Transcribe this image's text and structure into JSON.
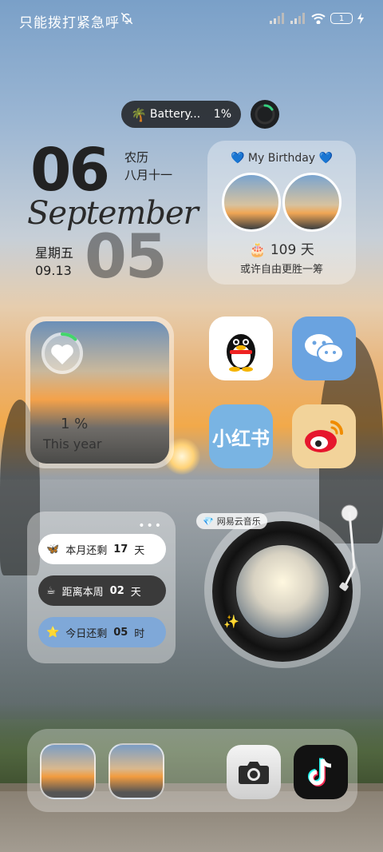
{
  "status_bar": {
    "carrier_text": "只能拨打紧急呼",
    "battery_level": "1"
  },
  "battery_widget": {
    "icon": "🌴",
    "name": "Battery...",
    "percent": "1%",
    "ring_level": 0.01
  },
  "date_widget": {
    "month_num": "06",
    "lunar_label": "农历",
    "lunar_date": "八月十一",
    "month_name": "September",
    "weekday": "星期五",
    "short_date": "09.13",
    "day_num": "05"
  },
  "birthday_widget": {
    "title_left_icon": "💙",
    "title": "My Birthday",
    "title_right_icon": "💙",
    "cake_icon": "🎂",
    "days": "109 天",
    "quote": "或许自由更胜一筹"
  },
  "progress_widget": {
    "percent": "1 %",
    "label": "This year",
    "progress": 0.01
  },
  "apps": {
    "qq": "QQ",
    "wechat": "WeChat",
    "xiaohongshu": "小红书",
    "weibo": "Weibo"
  },
  "countdown_widget": {
    "dots": "•••",
    "rows": [
      {
        "icon": "🦋",
        "label": "本月还剩",
        "value": "17",
        "unit": "天"
      },
      {
        "icon": "☕",
        "label": "距离本周",
        "value": "02",
        "unit": "天"
      },
      {
        "icon": "⭐",
        "label": "今日还剩",
        "value": "05",
        "unit": "时"
      }
    ]
  },
  "music_widget": {
    "badge_icon": "💎",
    "badge_text": "网易云音乐",
    "sparkle": "✨"
  },
  "dock": {
    "camera": "Camera",
    "tiktok": "TikTok"
  }
}
